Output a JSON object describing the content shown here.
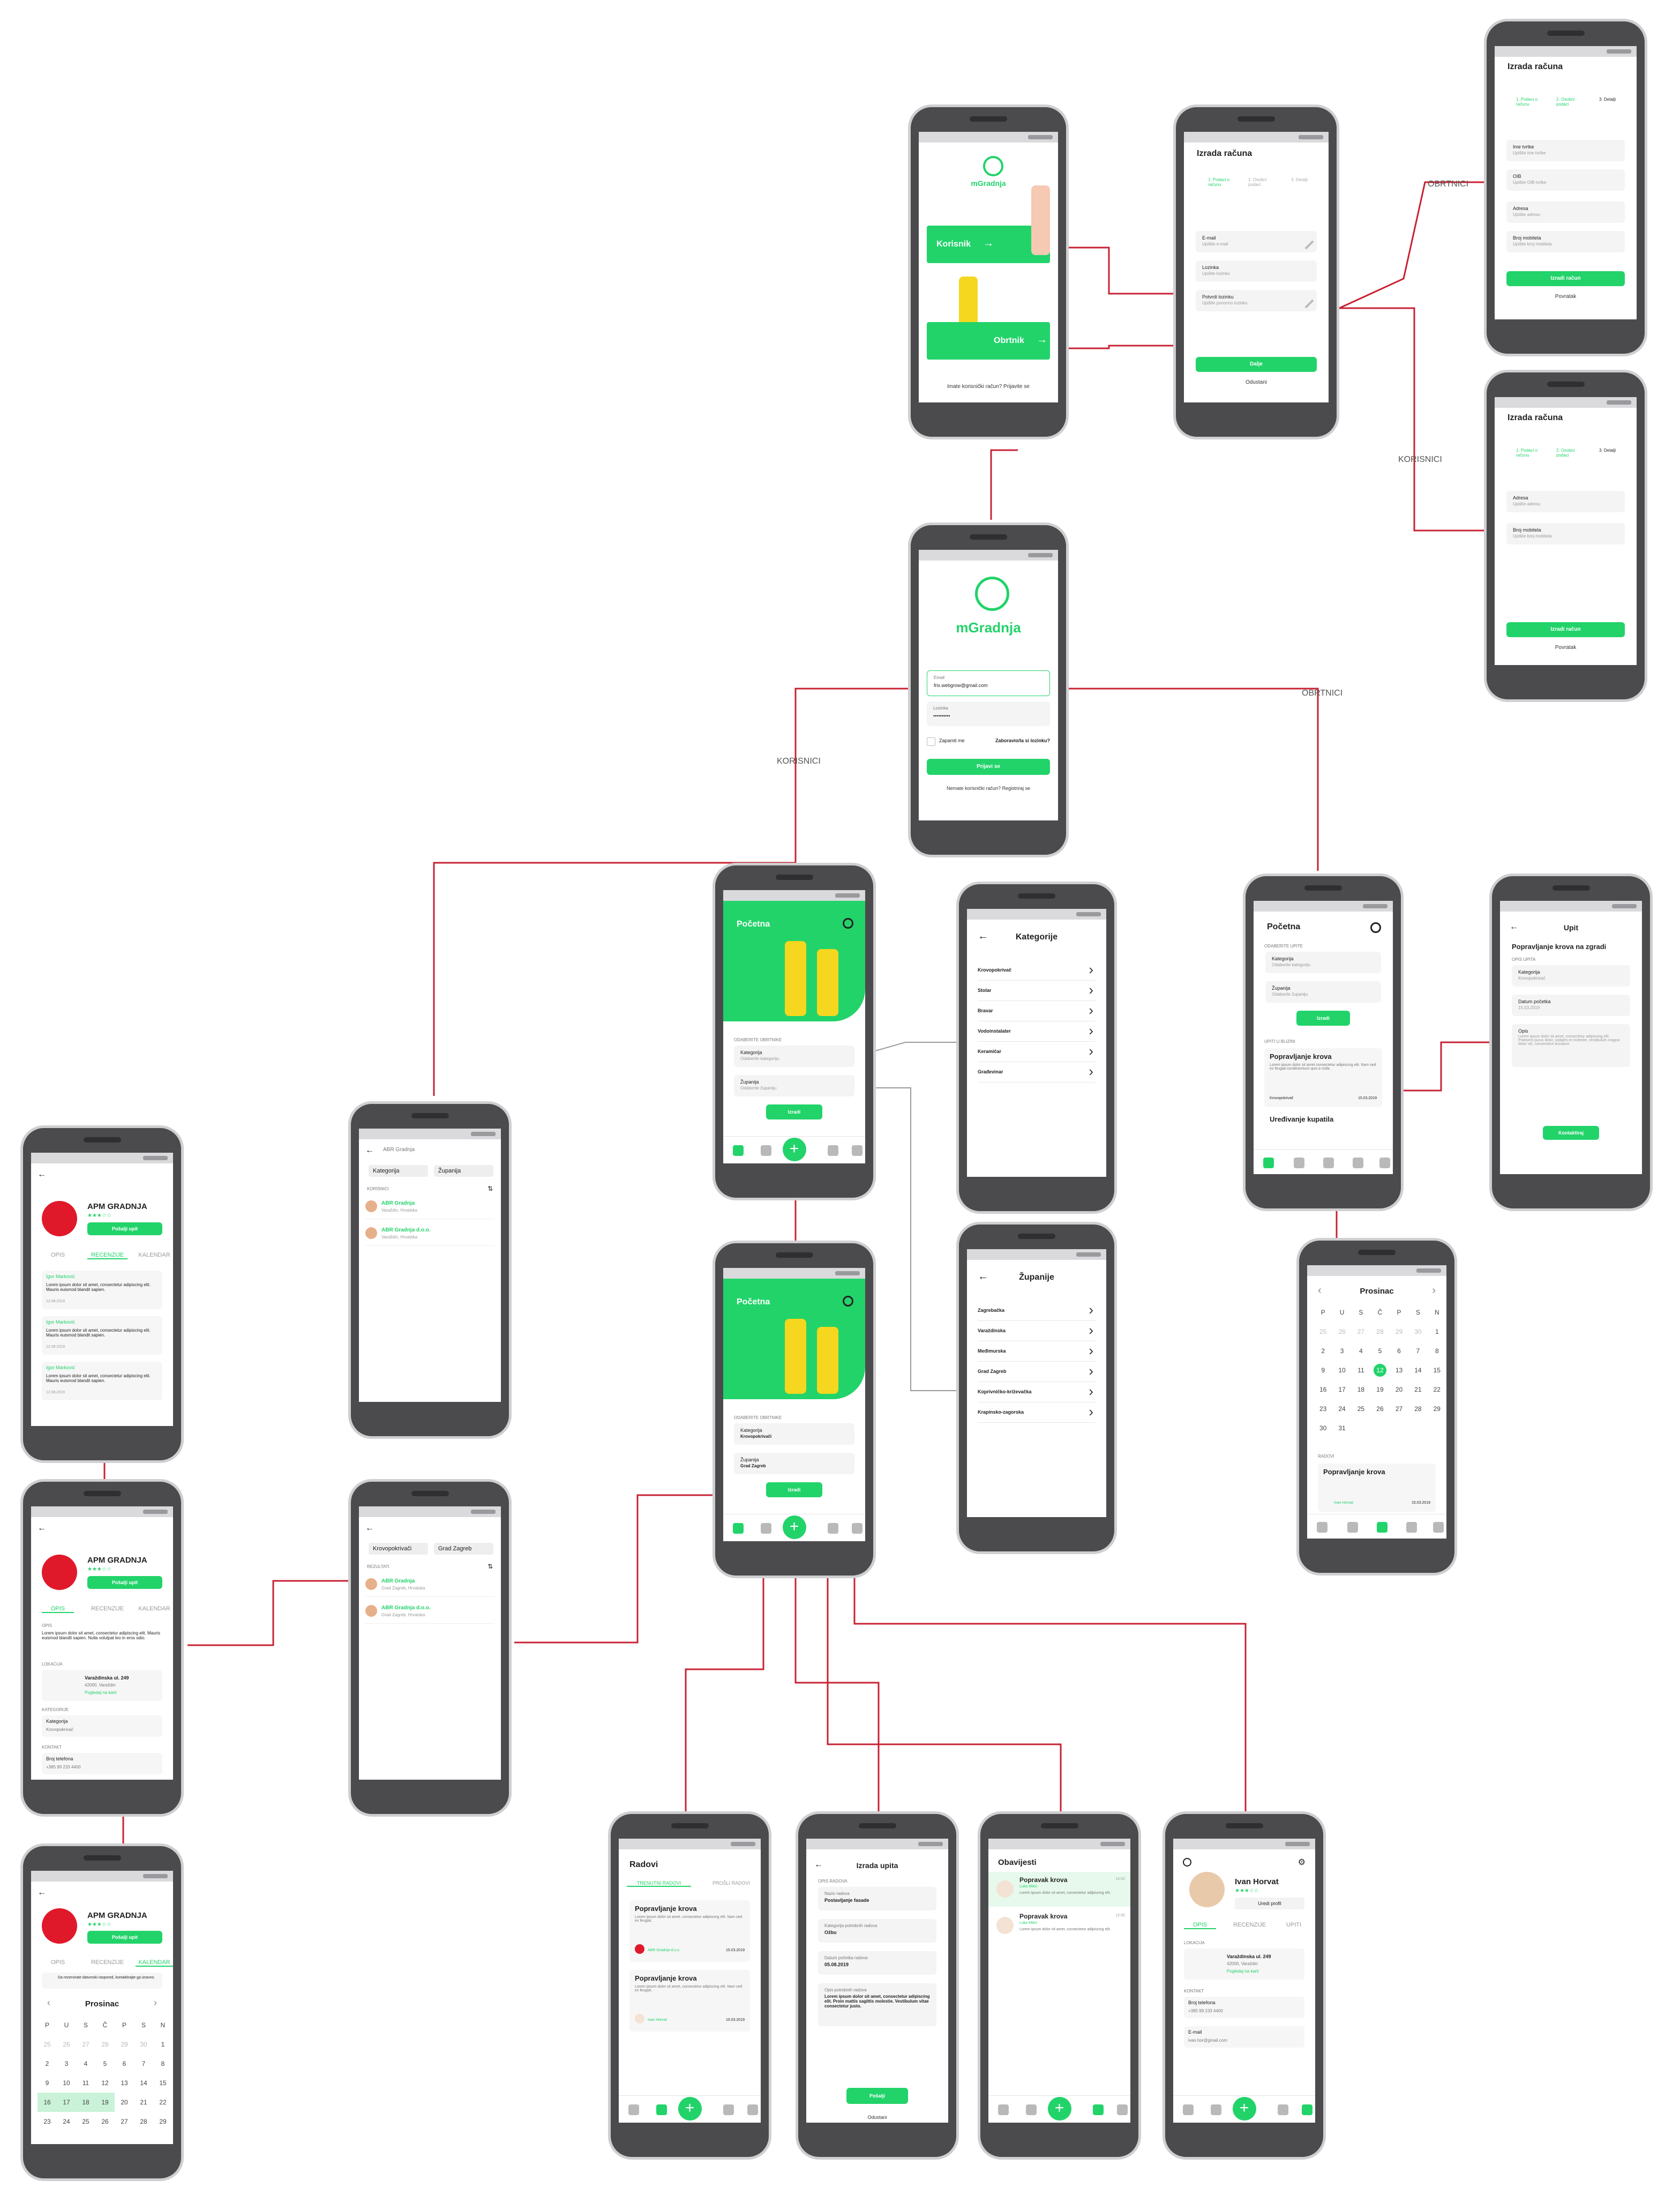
{
  "welcome": {
    "logo_text": "mGradnja",
    "korisnik_button": "Korisnik",
    "obrtnik_button": "Obrtnik",
    "account_prompt": "Imate korisnički račun? Prijavite se"
  },
  "signup_user": {
    "title": "Izrada računa",
    "steps": [
      "1. Podaci o računu",
      "2. Osobni podaci",
      "3. Detalji"
    ],
    "fields": [
      {
        "label": "E-mail",
        "placeholder": "Upišite e-mail"
      },
      {
        "label": "Lozinka",
        "placeholder": "Upišite lozinku"
      },
      {
        "label": "Potvrdi lozinku",
        "placeholder": "Upišite ponovno lozinku"
      }
    ],
    "next_button": "Dalje",
    "cancel_link": "Odustani"
  },
  "signup_obrtnik": {
    "title": "Izrada računa",
    "steps": [
      "1. Podaci o računu",
      "2. Osobni podaci",
      "3. Detalji"
    ],
    "fields": [
      {
        "label": "Ime tvrtke",
        "placeholder": "Upišite ime tvrtke"
      },
      {
        "label": "OIB",
        "placeholder": "Upišite OIB tvrtke"
      },
      {
        "label": "Adresa",
        "placeholder": "Upišite adresu"
      },
      {
        "label": "Broj mobitela",
        "placeholder": "Upišite broj mobitela"
      }
    ],
    "create_button": "Izradi račun",
    "back_link": "Povratak"
  },
  "signup_korisnik": {
    "title": "Izrada računa",
    "steps": [
      "1. Podaci o računu",
      "2. Osobni podaci",
      "3. Detalji"
    ],
    "fields": [
      {
        "label": "Adresa",
        "placeholder": "Upišite adresu"
      },
      {
        "label": "Broj mobitela",
        "placeholder": "Upišite broj mobitela"
      }
    ],
    "create_button": "Izradi račun",
    "back_link": "Povratak"
  },
  "login": {
    "logo_text": "mGradnja",
    "email_label": "Email",
    "email_value": "frix.webgrow@gmail.com",
    "password_label": "Lozinka",
    "password_value": "••••••••••",
    "remember": "Zapamti me",
    "forgot": "Zaboravio/la si lozinku?",
    "login_button": "Prijavi se",
    "register_prompt": "Nemate korisnički račun? Registriraj se"
  },
  "flow_labels": {
    "obrtnici_1": "OBRTNICI",
    "korisnici_1": "KORISNICI",
    "korisnici_2": "KORISNICI",
    "obrtnici_2": "OBRTNICI"
  },
  "home": {
    "title": "Početna",
    "filter_label": "ODABERITE OBRTNIKE",
    "kategorija_label": "Kategorija",
    "kategorija_placeholder": "Odaberite kategoriju",
    "zupanija_label": "Županija",
    "zupanija_placeholder": "Odaberite županiju",
    "search_button": "Izradi",
    "kategorija_value": "Krovopokrivači",
    "zupanija_value": "Grad Zagreb"
  },
  "kategorije": {
    "title": "Kategorije",
    "items": [
      "Krovopokrivač",
      "Stolar",
      "Bravar",
      "Vodoinstalater",
      "Keramičar",
      "Građevinar"
    ]
  },
  "zupanije": {
    "title": "Županije",
    "items": [
      "Zagrebačka",
      "Varaždinska",
      "Međimurska",
      "Grad Zagreb",
      "Koprivničko-križevačka",
      "Krapinsko-zagorska"
    ]
  },
  "results": {
    "search": "ABR Gradnja",
    "filter_a": "Kategorija",
    "filter_b": "Županija",
    "filter_a2": "Krovopokrivači",
    "filter_b2": "Grad Zagreb",
    "section": "KORISNICI",
    "section2": "REZULTATI",
    "items": [
      {
        "name": "ABR Gradnja",
        "sub": "Varaždin, Hrvatska"
      },
      {
        "name": "ABR Gradnja d.o.o.",
        "sub": "Varaždin, Hrvatska"
      }
    ],
    "items2": [
      {
        "name": "ABR Gradnja",
        "sub": "Grad Zagreb, Hrvatska"
      },
      {
        "name": "ABR Gradnja d.o.o.",
        "sub": "Grad Zagreb, Hrvatska"
      }
    ]
  },
  "profile": {
    "logo": "APM",
    "name": "APM GRADNJA",
    "rating_count": "(16)",
    "rating": 3,
    "action": "Pošalji upit",
    "tabs": [
      "OPIS",
      "RECENZIJE",
      "KALENDAR"
    ],
    "description_label": "OPIS",
    "description": "Lorem ipsum dolor sit amet, consectetur adipiscing elit. Mauris euismod blandit sapien. Nulla volutpat leo in eros odio.",
    "more": "Više",
    "location_label": "LOKACIJA",
    "address": "Varaždinska ul. 249",
    "city": "42000, Varaždin",
    "map_link": "Pogledaj na karti",
    "category_label": "KATEGORIJE",
    "category_field": "Kategorija",
    "category_value": "Krovopokrivač",
    "contact_label": "KONTAKT",
    "phone_label": "Broj telefona",
    "phone_value": "+385 99 233 4400",
    "reviewer": "Igor Marković",
    "review_text": "Lorem ipsum dolor sit amet, consectetur adipiscing elit. Mauris euismod blandit sapien.",
    "review_date": "12.08.2019",
    "calendar_note": "Da rezervirate datumski raspored, kontaktirajte ga izravno."
  },
  "calendar": {
    "month": "Prosinac",
    "days": [
      "P",
      "U",
      "S",
      "Č",
      "P",
      "S",
      "N"
    ],
    "radovi_label": "RADOVI",
    "job_title": "Popravljanje krova",
    "job_owner": "Ivan Horvat",
    "job_date": "15.03.2019"
  },
  "upit_list": {
    "title": "Početna",
    "filter_label": "ODABERITE UPITE",
    "kategorija": "Kategorija",
    "kategorija_ph": "Odaberite kategoriju",
    "zupanija": "Županija",
    "zupanija_ph": "Odaberite županiju",
    "button": "Izradi",
    "section": "UPITI U BLIZINI",
    "card_title": "Popravljanje krova",
    "card_text": "Lorem ipsum dolor sit amet consectetur adipiscing elit. Nam sed ex feugiat condimentum quis a nulla.",
    "card_category": "Krovopokrivač",
    "card_date": "15.03.2019",
    "card2_title": "Uređivanje kupatila"
  },
  "upit_detail": {
    "title": "Upit",
    "heading": "Popravljanje krova na zgradi",
    "section": "OPIS UPITA",
    "kategorija_label": "Kategorija",
    "kategorija_value": "Krovopokrivač",
    "datum_label": "Datum početka",
    "datum_value": "15.03.2019",
    "opis_label": "Opis",
    "opis_value": "Lorem ipsum dolor sit amet, consectetur adipiscing elit. Praesent purus dolor, sodales et molestie, vestibulum magna dolor vel, consectetur tincidunt.",
    "button": "Kontaktiraj"
  },
  "radovi": {
    "title": "Radovi",
    "tabs": [
      "TRENUTNI RADOVI",
      "PROŠLI RADOVI"
    ],
    "jobs": [
      {
        "title": "Popravljanje krova",
        "text": "Lorem ipsum dolor sit amet, consectetur adipiscing elit. Nam sed ex feugiat.",
        "who": "ABR Gradnja d.o.o.",
        "date": "15.03.2019"
      },
      {
        "title": "Popravljanje krova",
        "text": "Lorem ipsum dolor sit amet, consectetur adipiscing elit. Nam sed ex feugiat.",
        "who": "Ivan Horvat",
        "date": "15.03.2019"
      }
    ]
  },
  "izrada_upita": {
    "title": "Izrada upita",
    "section": "OPIS RADOVA",
    "fields": [
      {
        "label": "Naziv radova",
        "value": "Postavljanje fasade"
      },
      {
        "label": "Kategorija potrebnih radova",
        "value": "Ožbu"
      },
      {
        "label": "Datum početka radova",
        "value": "05.08.2019"
      },
      {
        "label": "Opis potrebnih radova",
        "value": "Lorem ipsum dolor sit amet, consectetur adipiscing elit. Proin mattis sagittis molestie. Vestibulum vitae consectetur justo."
      }
    ],
    "button": "Pošalji",
    "cancel": "Odustani"
  },
  "obavijesti": {
    "title": "Obavijesti",
    "items": [
      {
        "title": "Popravak krova",
        "who": "Luka Mikić",
        "text": "Lorem ipsum dolor sit amet, consectetur adipiscing elit.",
        "time": "12:02"
      },
      {
        "title": "Popravak krova",
        "who": "Luka Mikić",
        "text": "Lorem ipsum dolor sit amet, consectetur adipiscing elit.",
        "time": "12:02"
      }
    ]
  },
  "user_profile": {
    "name": "Ivan Horvat",
    "rating_count": "(16)",
    "edit": "Uredi profil",
    "tabs": [
      "OPIS",
      "RECENZIJE",
      "UPITI"
    ],
    "location_label": "LOKACIJA",
    "address": "Varaždinska ul. 249",
    "city": "42000, Varaždin",
    "map_link": "Pogledaj na karti",
    "contact_label": "KONTAKT",
    "phone_label": "Broj telefona",
    "phone_value": "+385 99 233 4400",
    "email_label": "E-mail",
    "email_value": "ivan.hor@gmail.com"
  },
  "colors": {
    "accent": "#22d36a",
    "connector": "#c82233",
    "phone_frame": "#4b4b4d"
  }
}
